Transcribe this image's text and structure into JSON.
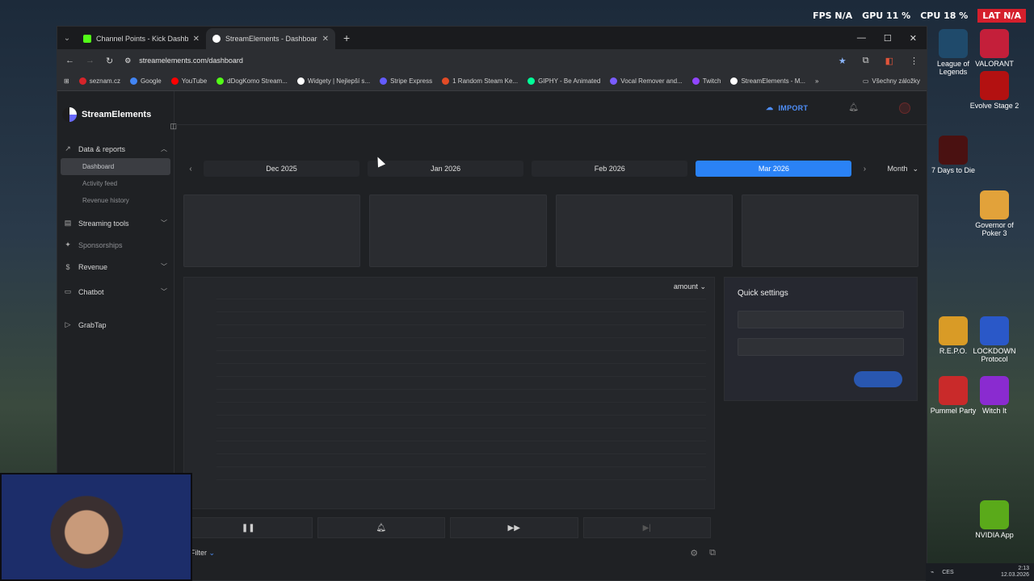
{
  "overlay": {
    "fps": "FPS N/A",
    "gpu": "GPU 11 %",
    "cpu": "CPU 18 %",
    "lat": "LAT N/A"
  },
  "desktop_icons": [
    {
      "label": "League of Legends",
      "color": "#1f4a6b"
    },
    {
      "label": "VALORANT",
      "color": "#c41f3a"
    },
    {
      "label": "Evolve Stage 2",
      "color": "#b31111"
    },
    {
      "label": "7 Days to Die",
      "color": "#4a1111"
    },
    {
      "label": "Governor of Poker 3",
      "color": "#e2a23a"
    },
    {
      "label": "R.E.P.O.",
      "color": "#d99b26"
    },
    {
      "label": "LOCKDOWN Protocol",
      "color": "#2a58c8"
    },
    {
      "label": "Pummel Party",
      "color": "#c92a2a"
    },
    {
      "label": "Witch It",
      "color": "#8a2bd0"
    },
    {
      "label": "NVIDIA App",
      "color": "#5aaa1a"
    }
  ],
  "browser": {
    "tabs": [
      {
        "title": "Channel Points - Kick Dashboa",
        "favicon_color": "#53fc18"
      },
      {
        "title": "StreamElements - Dashboard",
        "favicon_color": "#ffffff"
      }
    ],
    "url": "streamelements.com/dashboard",
    "bookmarks": [
      {
        "label": "seznam.cz",
        "color": "#d6242a"
      },
      {
        "label": "Google",
        "color": "#4285f4"
      },
      {
        "label": "YouTube",
        "color": "#ff0000"
      },
      {
        "label": "dDogKomo Stream...",
        "color": "#53fc18"
      },
      {
        "label": "Widgety | Nejlepší s...",
        "color": "#ffffff"
      },
      {
        "label": "Stripe Express",
        "color": "#635bff"
      },
      {
        "label": "1 Random Steam Ke...",
        "color": "#e24b26"
      },
      {
        "label": "GIPHY - Be Animated",
        "color": "#00ff99"
      },
      {
        "label": "Vocal Remover and...",
        "color": "#7a5cff"
      },
      {
        "label": "Twitch",
        "color": "#9146ff"
      },
      {
        "label": "StreamElements - M...",
        "color": "#ffffff"
      }
    ],
    "bookmarks_folder": "Všechny záložky"
  },
  "app": {
    "brand": "StreamElements",
    "import_label": "IMPORT",
    "nav": {
      "data_reports": "Data & reports",
      "dashboard": "Dashboard",
      "activity_feed": "Activity feed",
      "revenue_history": "Revenue history",
      "streaming_tools": "Streaming tools",
      "sponsorships": "Sponsorships",
      "revenue": "Revenue",
      "chatbot": "Chatbot",
      "grabtap": "GrabTap"
    },
    "periods": [
      "Dec 2025",
      "Jan 2026",
      "Feb 2026",
      "Mar 2026"
    ],
    "active_period": "Mar 2026",
    "granularity": "Month",
    "chart_sort": "amount",
    "quick_settings_title": "Quick settings",
    "filter_label": "Filter"
  },
  "taskbar": {
    "lang": "CES",
    "time": "2:13",
    "date": "12.03.2026"
  }
}
